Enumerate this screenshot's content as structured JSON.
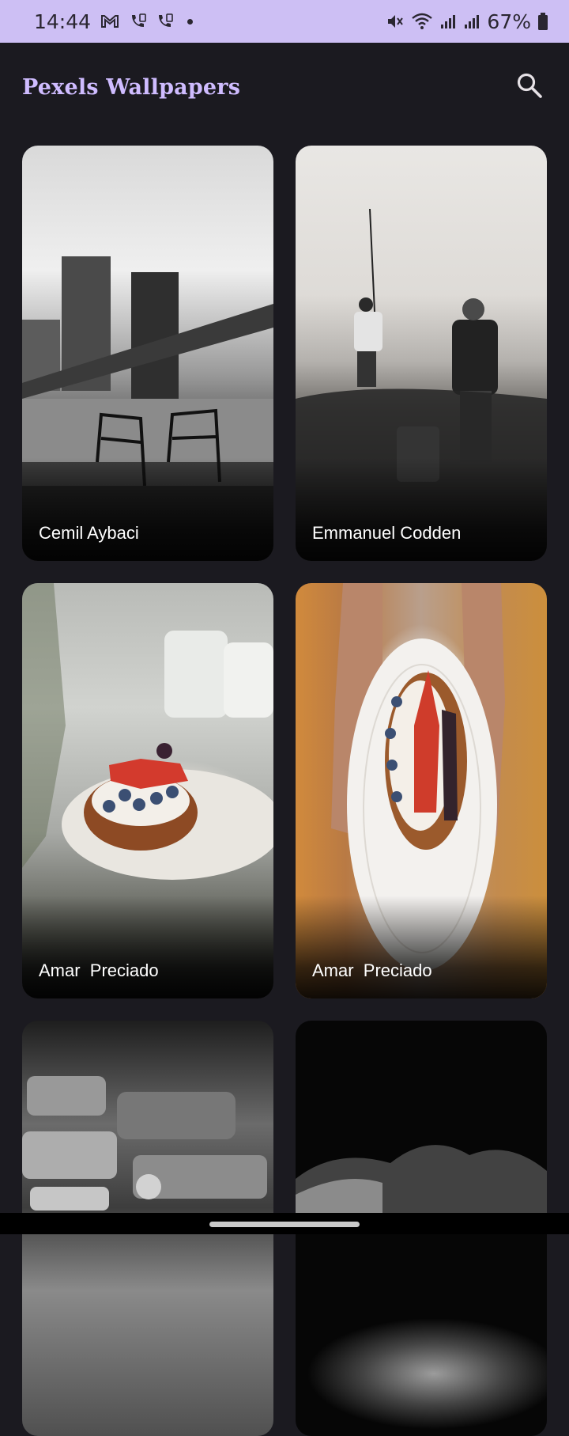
{
  "status_bar": {
    "time": "14:44",
    "battery": "67%",
    "left_icons": [
      "gmail-icon",
      "call-sim1-icon",
      "call-sim2-icon",
      "notification-dot-icon"
    ],
    "right_icons": [
      "mute-icon",
      "wifi-icon",
      "signal-sim1-icon",
      "signal-sim2-icon",
      "battery-icon"
    ]
  },
  "app_bar": {
    "title": "Pexels Wallpapers",
    "search_icon": "search-icon"
  },
  "wallpapers": [
    {
      "photographer": "Cemil Aybaci"
    },
    {
      "photographer": "Emmanuel Codden"
    },
    {
      "photographer": "Amar  Preciado"
    },
    {
      "photographer": "Amar  Preciado"
    },
    {
      "photographer": ""
    },
    {
      "photographer": ""
    }
  ],
  "colors": {
    "status_bar_bg": "#cdbff4",
    "app_bg": "#1b1a20",
    "title_accent": "#cfbcff"
  }
}
